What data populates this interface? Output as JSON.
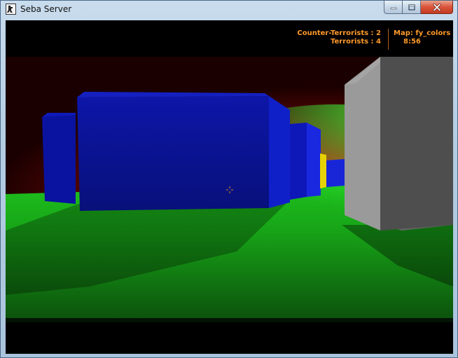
{
  "window": {
    "title": "Seba Server",
    "icon": "counter-strike-app-icon",
    "controls": [
      "minimize-icon",
      "maximize-icon",
      "close-icon"
    ]
  },
  "hud": {
    "ct_label": "Counter-Terrorists :",
    "ct_count": "2",
    "t_label": "Terrorists :",
    "t_count": "4",
    "map_label": "Map:",
    "map_name": "fy_colors",
    "timer": "8:56",
    "color": "#ff9a2a"
  },
  "scene": {
    "floor_color": "#1db81d",
    "wall_color": "#c81414",
    "box_colors": [
      "#0d17b0",
      "#1221d0",
      "#e8d400",
      "#7a7a7a"
    ]
  }
}
